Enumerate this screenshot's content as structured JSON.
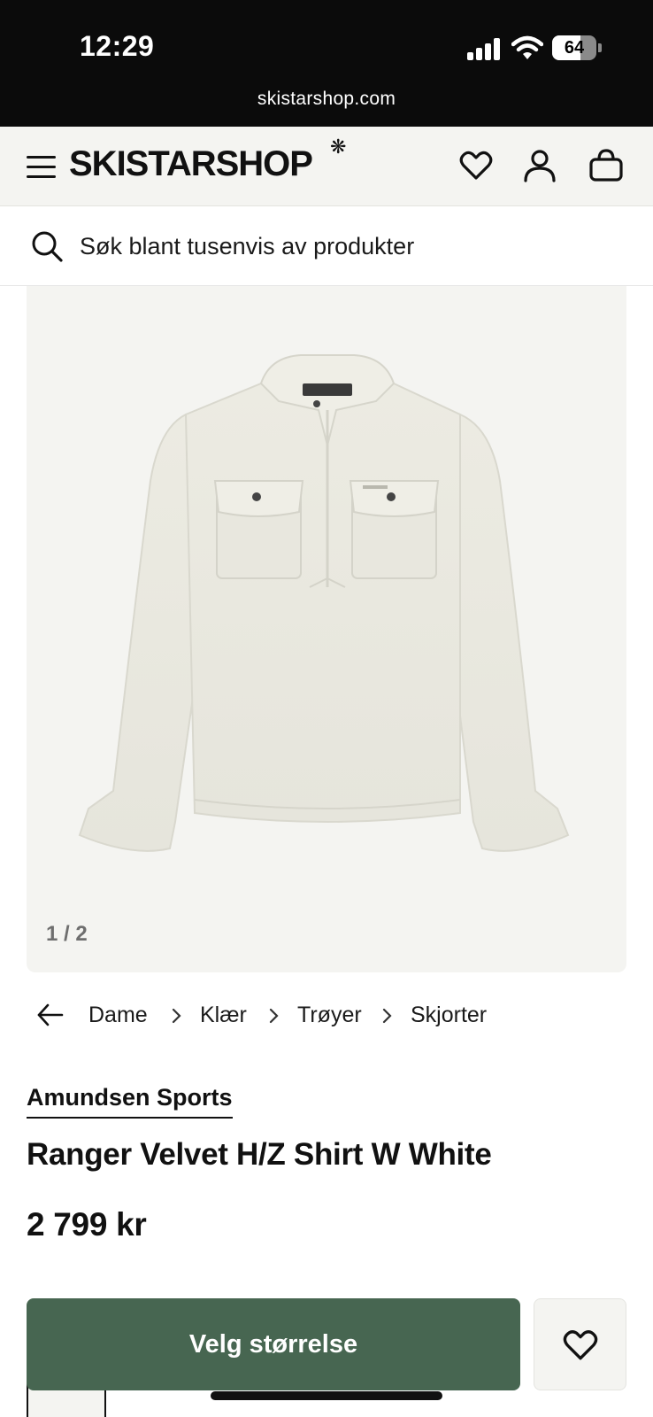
{
  "status_bar": {
    "time": "12:29",
    "battery_level": "64",
    "battery_fraction": 0.64,
    "url": "skistarshop.com"
  },
  "header": {
    "logo_text": "SKISTARSHOP",
    "logo_mark": "❋",
    "icons": [
      "menu-icon",
      "heart-icon",
      "user-icon",
      "bag-icon"
    ]
  },
  "search": {
    "placeholder": "Søk blant tusenvis av produkter"
  },
  "gallery": {
    "counter": "1 / 2",
    "current": 1,
    "total": 2,
    "background": "#f4f4f1"
  },
  "breadcrumb": {
    "items": [
      "Dame",
      "Klær",
      "Trøyer",
      "Skjorter"
    ]
  },
  "product": {
    "brand": "Amundsen Sports",
    "title": "Ranger Velvet H/Z Shirt W White",
    "price": "2 799 kr"
  },
  "actions": {
    "select_size_label": "Velg størrelse",
    "primary_color": "#476651"
  }
}
